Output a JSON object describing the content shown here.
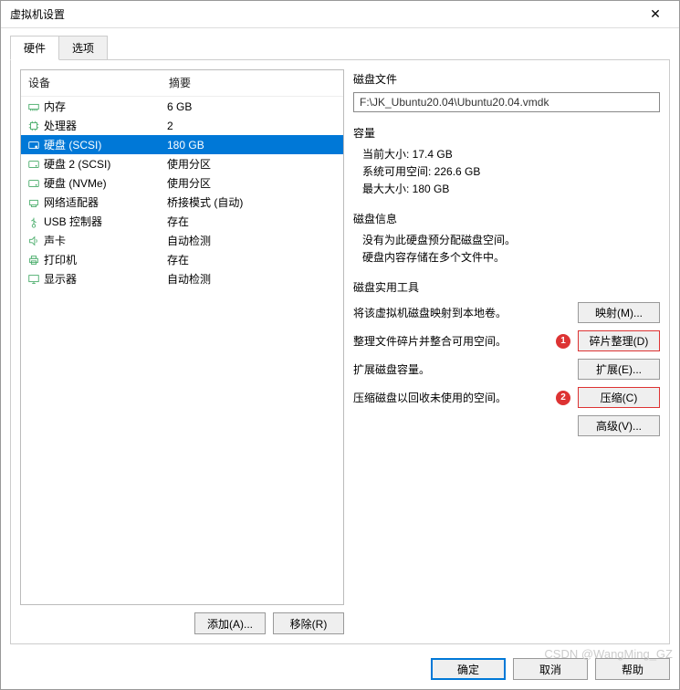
{
  "title": "虚拟机设置",
  "tabs": {
    "hardware": "硬件",
    "options": "选项"
  },
  "device_header": {
    "device": "设备",
    "summary": "摘要"
  },
  "devices": [
    {
      "icon": "memory-icon",
      "name": "内存",
      "summary": "6 GB"
    },
    {
      "icon": "cpu-icon",
      "name": "处理器",
      "summary": "2"
    },
    {
      "icon": "disk-icon",
      "name": "硬盘  (SCSI)",
      "summary": "180 GB",
      "selected": true
    },
    {
      "icon": "disk-icon",
      "name": "硬盘 2 (SCSI)",
      "summary": "使用分区"
    },
    {
      "icon": "disk-icon",
      "name": "硬盘 (NVMe)",
      "summary": "使用分区"
    },
    {
      "icon": "network-icon",
      "name": "网络适配器",
      "summary": "桥接模式 (自动)"
    },
    {
      "icon": "usb-icon",
      "name": "USB 控制器",
      "summary": "存在"
    },
    {
      "icon": "sound-icon",
      "name": "声卡",
      "summary": "自动检测"
    },
    {
      "icon": "printer-icon",
      "name": "打印机",
      "summary": "存在"
    },
    {
      "icon": "display-icon",
      "name": "显示器",
      "summary": "自动检测"
    }
  ],
  "left_buttons": {
    "add": "添加(A)...",
    "remove": "移除(R)"
  },
  "groups": {
    "disk_file": {
      "title": "磁盘文件",
      "path": "F:\\JK_Ubuntu20.04\\Ubuntu20.04.vmdk"
    },
    "capacity": {
      "title": "容量",
      "current": "当前大小: 17.4 GB",
      "free": "系统可用空间: 226.6 GB",
      "max": "最大大小: 180 GB"
    },
    "disk_info": {
      "title": "磁盘信息",
      "line1": "没有为此硬盘预分配磁盘空间。",
      "line2": "硬盘内容存储在多个文件中。"
    },
    "disk_tools": {
      "title": "磁盘实用工具",
      "map_desc": "将该虚拟机磁盘映射到本地卷。",
      "map_btn": "映射(M)...",
      "defrag_desc": "整理文件碎片并整合可用空间。",
      "defrag_btn": "碎片整理(D)",
      "expand_desc": "扩展磁盘容量。",
      "expand_btn": "扩展(E)...",
      "compact_desc": "压缩磁盘以回收未使用的空间。",
      "compact_btn": "压缩(C)",
      "adv_btn": "高级(V)..."
    }
  },
  "markers": {
    "one": "1",
    "two": "2"
  },
  "footer": {
    "ok": "确定",
    "cancel": "取消",
    "help": "帮助"
  },
  "watermark": "CSDN @WangMing_GZ"
}
